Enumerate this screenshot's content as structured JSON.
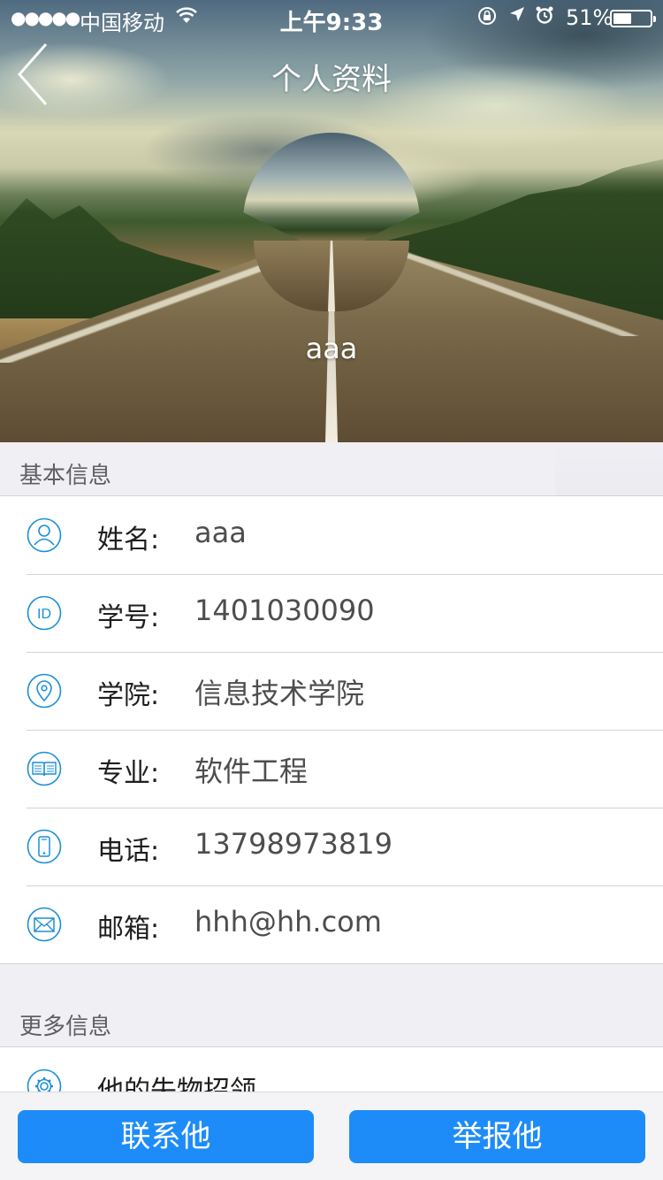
{
  "status_bar": {
    "signal": "●●●●●",
    "carrier": "中国移动",
    "wifi_icon": "wifi-icon",
    "time": "上午9:33",
    "battery_percent": "51%",
    "battery_level": 0.51
  },
  "nav": {
    "title": "个人资料",
    "back_icon": "chevron-left-icon"
  },
  "profile": {
    "username": "aaa"
  },
  "basic_section": {
    "title": "基本信息",
    "rows": [
      {
        "icon": "user-icon",
        "label": "姓名:",
        "value": "aaa"
      },
      {
        "icon": "id-icon",
        "label": "学号:",
        "value": "1401030090"
      },
      {
        "icon": "location-pin-icon",
        "label": "学院:",
        "value": "信息技术学院"
      },
      {
        "icon": "book-icon",
        "label": "专业:",
        "value": "软件工程"
      },
      {
        "icon": "phone-icon",
        "label": "电话:",
        "value": "13798973819"
      },
      {
        "icon": "mail-icon",
        "label": "邮箱:",
        "value": "hhh@hh.com"
      }
    ]
  },
  "more_section": {
    "title": "更多信息",
    "rows": [
      {
        "icon": "gear-icon",
        "label": "他的失物招领"
      }
    ]
  },
  "actions": {
    "contact_label": "联系他",
    "report_label": "举报他"
  },
  "colors": {
    "accent": "#1d8cf8",
    "icon_blue": "#1a8fd8",
    "background": "#efeff4"
  }
}
